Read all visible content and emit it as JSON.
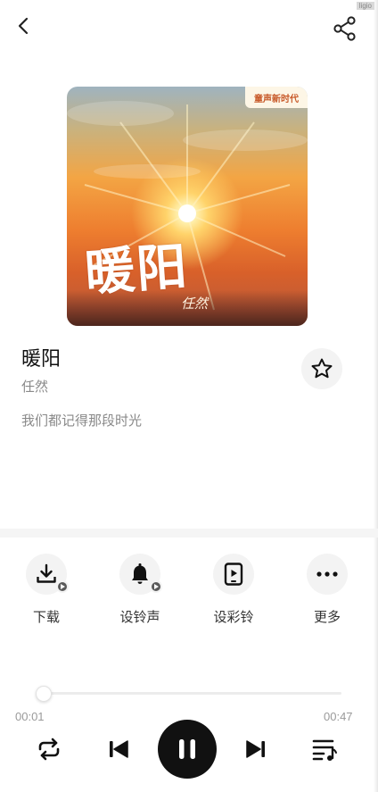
{
  "corner_tag": "ligio",
  "song": {
    "title": "暖阳",
    "artist": "任然",
    "lyric": "我们都记得那段时光"
  },
  "cover": {
    "title_art": "暖阳",
    "artist_art": "任然",
    "badge": "童声新时代"
  },
  "actions": [
    {
      "label": "下载",
      "icon": "download-icon"
    },
    {
      "label": "设铃声",
      "icon": "bell-icon"
    },
    {
      "label": "设彩铃",
      "icon": "phone-video-icon"
    },
    {
      "label": "更多",
      "icon": "more-dots-icon"
    }
  ],
  "player": {
    "current_time": "00:01",
    "total_time": "00:47",
    "progress": 0.02,
    "state": "playing"
  }
}
